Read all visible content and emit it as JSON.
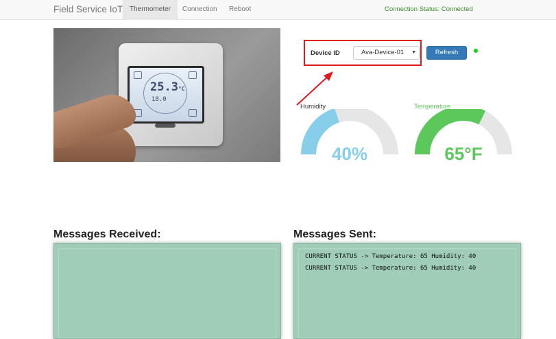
{
  "navbar": {
    "brand": "Field Service IoT",
    "items": [
      {
        "label": "Thermometer",
        "active": true
      },
      {
        "label": "Connection",
        "active": false
      },
      {
        "label": "Reboot",
        "active": false
      }
    ],
    "connection_status": "Connection Status: Connected"
  },
  "thermostat_display": {
    "temperature": "25.3",
    "unit": "°C",
    "secondary": "18.0"
  },
  "device": {
    "label": "Device ID",
    "selected": "Ava-Device-01",
    "refresh_label": "Refresh",
    "status_color": "#11d611"
  },
  "gauges": {
    "humidity": {
      "label": "Humidity",
      "value": 40,
      "display": "40%",
      "min": 0,
      "max": 100,
      "color": "#87ceeb"
    },
    "temperature": {
      "label": "Temperature",
      "value": 65,
      "display": "65°F",
      "min": 0,
      "max": 100,
      "color": "#5cc85c"
    }
  },
  "messages": {
    "received_title": "Messages Received:",
    "received": [],
    "sent_title": "Messages Sent:",
    "sent": [
      "CURRENT STATUS -> Temperature: 65 Humidity: 40",
      "CURRENT STATUS -> Temperature: 65 Humidity: 40"
    ]
  },
  "colors": {
    "message_panel": "#9fcdb7",
    "primary_button": "#337ab7",
    "highlight": "#e0191e"
  }
}
